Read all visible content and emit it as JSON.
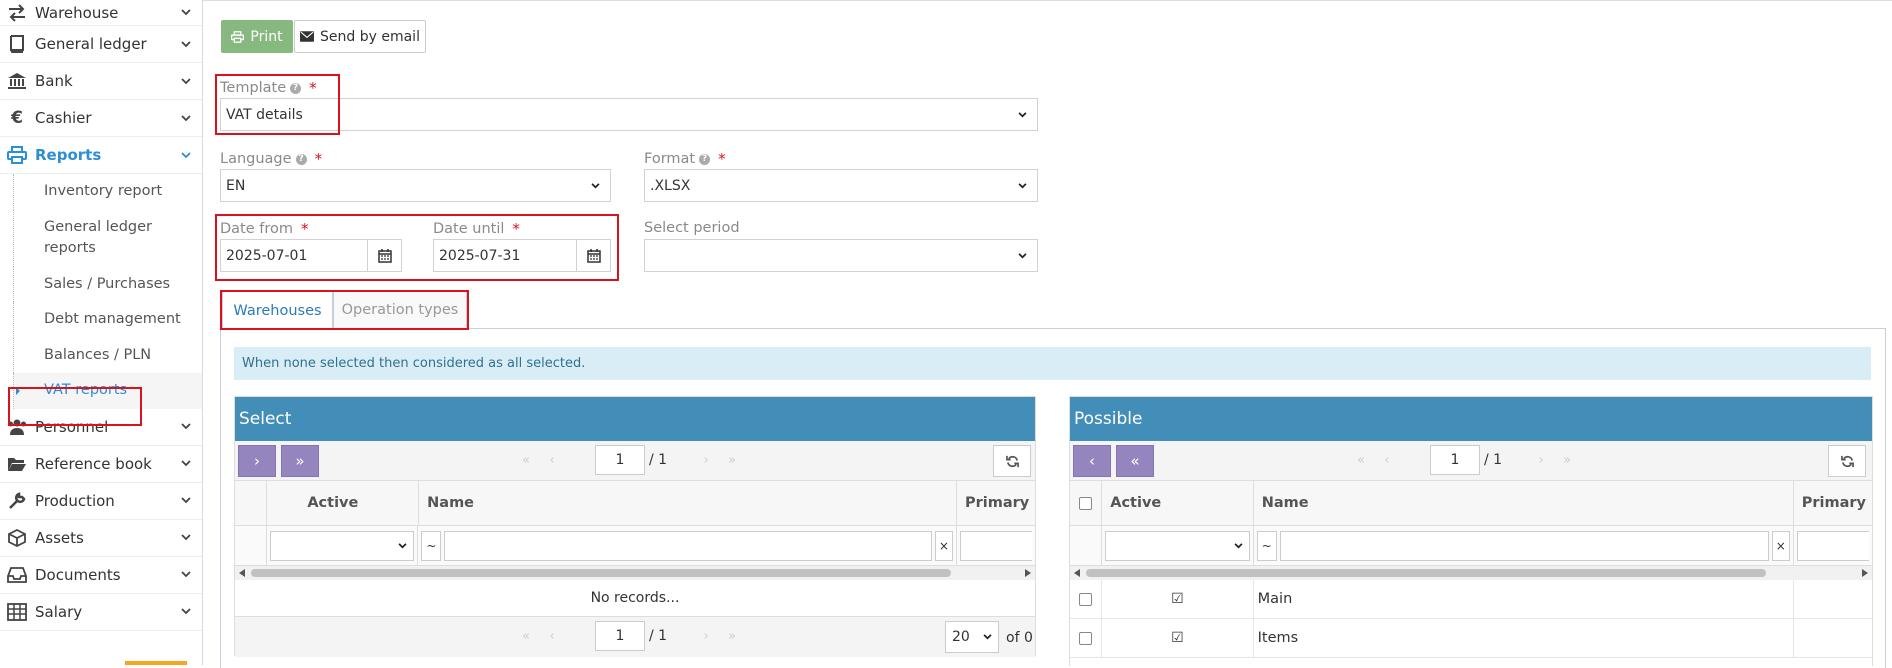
{
  "sidebar": {
    "items": [
      {
        "label": "Warehouse",
        "icon": "exchange-icon"
      },
      {
        "label": "General ledger",
        "icon": "book-icon"
      },
      {
        "label": "Bank",
        "icon": "bank-icon"
      },
      {
        "label": "Cashier",
        "icon": "euro-icon"
      },
      {
        "label": "Reports",
        "icon": "print-icon"
      },
      {
        "label": "Personnel",
        "icon": "users-icon"
      },
      {
        "label": "Reference book",
        "icon": "folder-open-icon"
      },
      {
        "label": "Production",
        "icon": "wrench-icon"
      },
      {
        "label": "Assets",
        "icon": "cube-icon"
      },
      {
        "label": "Documents",
        "icon": "inbox-icon"
      },
      {
        "label": "Salary",
        "icon": "table-icon"
      }
    ],
    "reports_sub": [
      "Inventory report",
      "General ledger reports",
      "Sales / Purchases",
      "Debt management",
      "Balances / PLN",
      "VAT reports"
    ]
  },
  "toolbar": {
    "print_label": "Print",
    "email_label": "Send by email"
  },
  "form": {
    "template_label": "Template",
    "template_value": "VAT details",
    "language_label": "Language",
    "language_value": "EN",
    "format_label": "Format",
    "format_value": ".XLSX",
    "date_from_label": "Date from",
    "date_from_value": "2025-07-01",
    "date_until_label": "Date until",
    "date_until_value": "2025-07-31",
    "period_label": "Select period",
    "period_value": "",
    "required_mark": "*"
  },
  "tabs": {
    "warehouses": "Warehouses",
    "operation_types": "Operation types"
  },
  "info_text": "When none selected then considered as all selected.",
  "select_panel": {
    "title": "Select",
    "page": "1",
    "page_of": "/ 1",
    "col_active": "Active",
    "col_name": "Name",
    "col_primary": "Primary",
    "tilde": "~",
    "clear": "×",
    "empty_text": "No records...",
    "page_size": "20",
    "total_of": "of 0"
  },
  "possible_panel": {
    "title": "Possible",
    "page": "1",
    "page_of": "/ 1",
    "col_active": "Active",
    "col_name": "Name",
    "col_primary": "Primary",
    "tilde": "~",
    "clear": "×",
    "rows": [
      {
        "name": "Main",
        "active": true
      },
      {
        "name": "Items",
        "active": true
      }
    ]
  },
  "colors": {
    "accent": "#2b8fd6",
    "panel_header": "#438eb9",
    "print_button": "#87b87f",
    "highlight": "#d9131d",
    "nav_button": "#9585bf"
  }
}
